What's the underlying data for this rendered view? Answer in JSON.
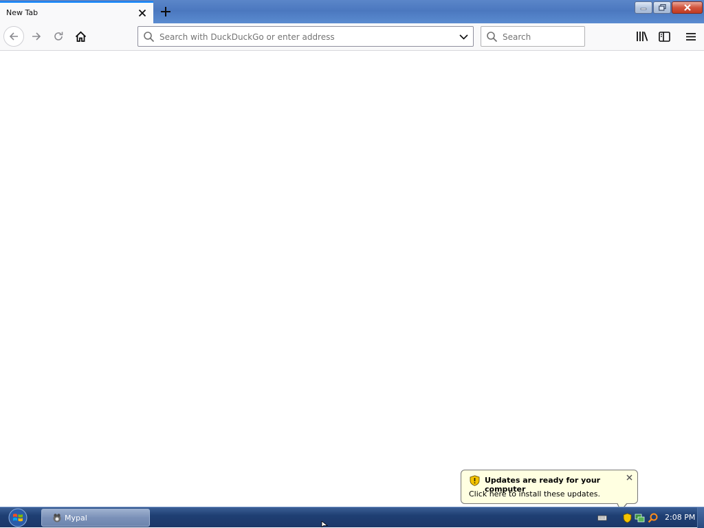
{
  "browser": {
    "tab": {
      "title": "New Tab"
    },
    "urlbar": {
      "placeholder": "Search with DuckDuckGo or enter address",
      "value": ""
    },
    "searchbar": {
      "placeholder": "Search",
      "value": ""
    }
  },
  "notification": {
    "title": "Updates are ready for your computer",
    "message": "Click here to install these updates."
  },
  "taskbar": {
    "items": [
      {
        "label": "Mypal"
      }
    ],
    "clock": "2:08 PM"
  },
  "colors": {
    "accent": "#0a84ff",
    "taskbar": "#1f3f73",
    "balloon": "#ffffe1"
  },
  "icons": {
    "tab": [
      "close-icon",
      "plus-icon"
    ],
    "nav": [
      "back-arrow-icon",
      "forward-arrow-icon",
      "reload-icon",
      "home-icon"
    ],
    "toolbar": [
      "library-icon",
      "sidebar-icon",
      "hamburger-menu-icon"
    ],
    "tray": [
      "keyboard-icon",
      "shield-icon",
      "network-icon",
      "search-icon"
    ]
  }
}
